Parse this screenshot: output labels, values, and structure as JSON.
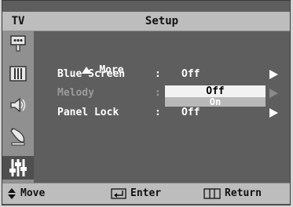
{
  "header": {
    "source": "TV",
    "title": "Setup"
  },
  "sidebar": {
    "icons": [
      "input-icon",
      "picture-icon",
      "sound-icon",
      "channel-icon",
      "setup-icon"
    ],
    "active": "setup-icon"
  },
  "menu": {
    "more_label": "More",
    "items": [
      {
        "label": "Blue Screen",
        "value": "Off",
        "enabled": true
      },
      {
        "label": "Melody",
        "value": "",
        "enabled": false
      },
      {
        "label": "Panel Lock",
        "value": "Off",
        "enabled": true
      }
    ],
    "separator": ":"
  },
  "dropdown": {
    "options": [
      "Off",
      "On"
    ],
    "selected": "Off"
  },
  "footer": {
    "move": "Move",
    "enter": "Enter",
    "return": "Return"
  },
  "colors": {
    "background": "#5e5e5e",
    "bar": "#bdbdbd",
    "sidebar": "#909090",
    "text": "#ffffff",
    "disabled": "#9a9a9a"
  }
}
